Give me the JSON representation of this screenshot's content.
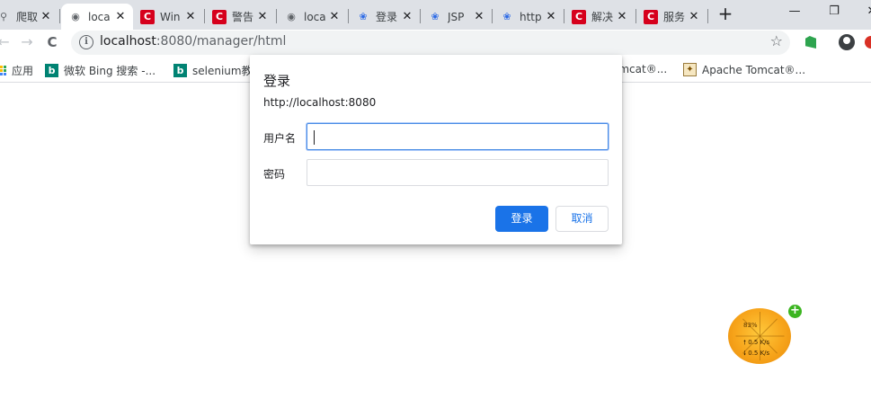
{
  "browser": {
    "tabs": [
      {
        "icon": "spider-icon",
        "title": "爬取"
      },
      {
        "icon": "globe-icon",
        "title": "loca",
        "active": true
      },
      {
        "icon": "c-icon",
        "title": "Win"
      },
      {
        "icon": "c-icon",
        "title": "警告"
      },
      {
        "icon": "globe-icon",
        "title": "loca"
      },
      {
        "icon": "paw-icon",
        "title": "登录"
      },
      {
        "icon": "paw-icon",
        "title": "JSP"
      },
      {
        "icon": "paw-icon",
        "title": "http"
      },
      {
        "icon": "c-icon",
        "title": "解决"
      },
      {
        "icon": "c-icon",
        "title": "服务"
      }
    ],
    "new_tab_label": "+",
    "window_controls": {
      "minimize": "—",
      "restore": "❐",
      "close": "✕"
    },
    "toolbar": {
      "back_icon": "←",
      "forward_icon": "→",
      "reload_icon": "C",
      "url_host": "localhost",
      "url_path": ":8080/manager/html",
      "star_icon": "☆"
    },
    "bookmarks": [
      {
        "icon": "apps-icon",
        "label": "应用"
      },
      {
        "icon": "bing-icon",
        "label": "微软 Bing 搜索 -..."
      },
      {
        "icon": "bing-icon",
        "label": "selenium教程"
      },
      {
        "icon": "tomcat-icon",
        "label": "omcat®..."
      },
      {
        "icon": "tomcat-icon",
        "label": "Apache Tomcat®..."
      }
    ]
  },
  "dialog": {
    "title": "登录",
    "origin": "http://localhost:8080",
    "username_label": "用户名",
    "username_value": "",
    "password_label": "密码",
    "password_value": "",
    "login_button": "登录",
    "cancel_button": "取消"
  },
  "widget": {
    "percent": "83%",
    "upload": "0.5 K/s",
    "download": "0.5 K/s",
    "plus": "+"
  },
  "colors": {
    "accent": "#1a73e8",
    "tab_strip": "#dee1e6",
    "brand_red": "#d6001c"
  }
}
